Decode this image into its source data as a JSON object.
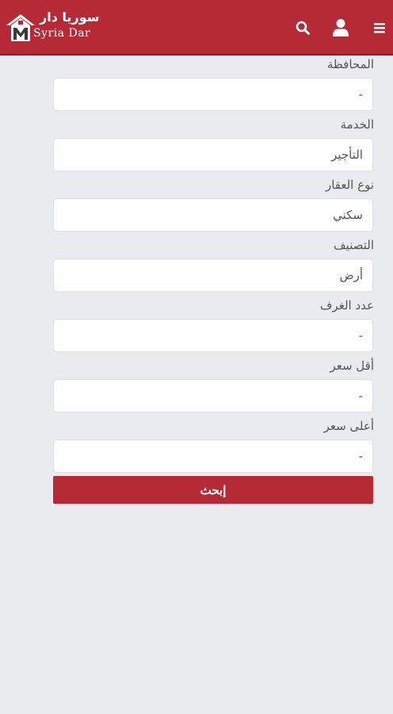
{
  "header": {
    "brand_ar": "سوريا دار",
    "brand_en": "Syria Dar",
    "icons": [
      "search-icon",
      "user-icon",
      "menu-icon"
    ],
    "bg_color": "#b52a35"
  },
  "form": {
    "fields": [
      {
        "label": "المحافظة",
        "value": "-"
      },
      {
        "label": "الخدمة",
        "value": "التأجير"
      },
      {
        "label": "نوع العقار",
        "value": "سكني"
      },
      {
        "label": "التصنيف",
        "value": "أرض"
      },
      {
        "label": "عدد الغرف",
        "value": "-"
      },
      {
        "label": "أقل سعر",
        "value": "-"
      },
      {
        "label": "أعلى سعر",
        "value": "-"
      }
    ],
    "submit_label": "إبحث"
  }
}
